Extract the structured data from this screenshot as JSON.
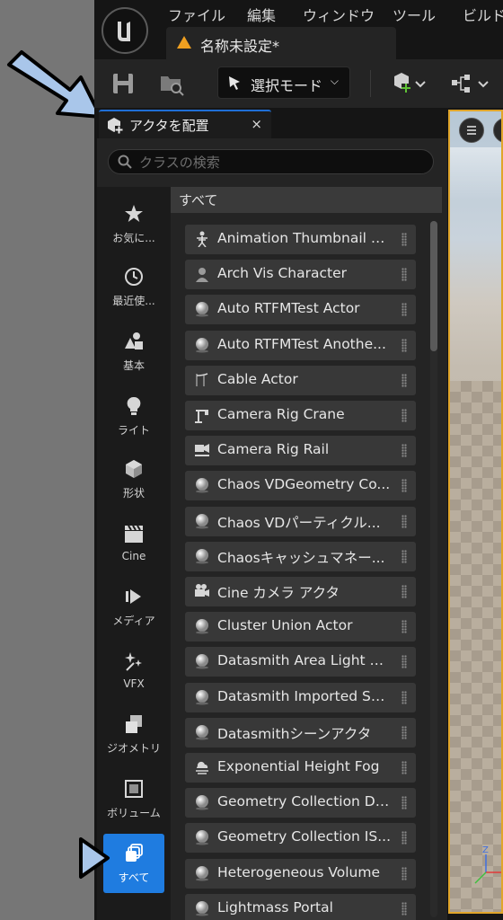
{
  "menu": [
    "ファイル",
    "編集",
    "ウィンドウ",
    "ツール",
    "ビルド"
  ],
  "document_tab": {
    "title": "名称未設定*"
  },
  "toolbar": {
    "mode_label": "選択モード"
  },
  "panel": {
    "title": "アクタを配置",
    "close": "×",
    "search_placeholder": "クラスの検索",
    "list_header": "すべて",
    "categories": [
      {
        "label": "お気に...",
        "icon": "star-icon"
      },
      {
        "label": "最近使...",
        "icon": "clock-icon"
      },
      {
        "label": "基本",
        "icon": "basic-shapes-icon"
      },
      {
        "label": "ライト",
        "icon": "bulb-icon"
      },
      {
        "label": "形状",
        "icon": "cube-icon"
      },
      {
        "label": "Cine",
        "icon": "clapper-icon"
      },
      {
        "label": "メディア",
        "icon": "media-icon"
      },
      {
        "label": "VFX",
        "icon": "sparkle-icon"
      },
      {
        "label": "ジオメトリ",
        "icon": "geometry-icon"
      },
      {
        "label": "ボリューム",
        "icon": "volume-icon"
      },
      {
        "label": "すべて",
        "icon": "all-classes-icon",
        "active": true
      }
    ],
    "items": [
      {
        "label": "Animation Thumbnail S...",
        "icon": "skeleton-icon"
      },
      {
        "label": "Arch Vis Character",
        "icon": "character-icon"
      },
      {
        "label": "Auto RTFMTest Actor",
        "icon": "sphere-icon"
      },
      {
        "label": "Auto RTFMTest Anothe...",
        "icon": "sphere-icon"
      },
      {
        "label": "Cable Actor",
        "icon": "cable-icon"
      },
      {
        "label": "Camera Rig Crane",
        "icon": "crane-icon"
      },
      {
        "label": "Camera Rig Rail",
        "icon": "rail-icon"
      },
      {
        "label": "Chaos VDGeometry Co...",
        "icon": "sphere-icon"
      },
      {
        "label": "Chaos VDパーティクル...",
        "icon": "sphere-icon"
      },
      {
        "label": "Chaosキャッシュマネー...",
        "icon": "sphere-icon"
      },
      {
        "label": "Cine カメラ アクタ",
        "icon": "camera-icon"
      },
      {
        "label": "Cluster Union Actor",
        "icon": "sphere-icon"
      },
      {
        "label": "Datasmith Area Light A...",
        "icon": "sphere-icon"
      },
      {
        "label": "Datasmith Imported Se...",
        "icon": "sphere-icon"
      },
      {
        "label": "Datasmithシーンアクタ",
        "icon": "sphere-icon"
      },
      {
        "label": "Exponential Height Fog",
        "icon": "fog-icon"
      },
      {
        "label": "Geometry Collection De...",
        "icon": "sphere-icon"
      },
      {
        "label": "Geometry Collection IS...",
        "icon": "sphere-icon"
      },
      {
        "label": "Heterogeneous Volume",
        "icon": "sphere-icon"
      },
      {
        "label": "Lightmass Portal",
        "icon": "sphere-icon"
      }
    ]
  },
  "colors": {
    "accent": "#1f7ce0",
    "viewport_border": "#e0a52a",
    "annotation_arrow": "#a9c6ea"
  }
}
